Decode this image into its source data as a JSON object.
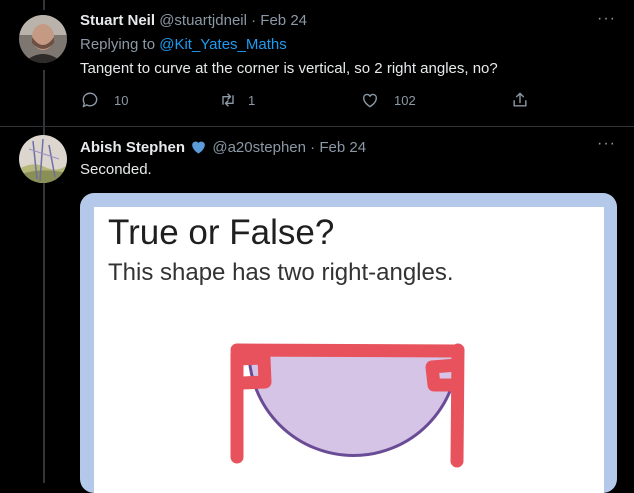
{
  "tweet1": {
    "name": "Stuart Neil",
    "handle": "@stuartjdneil",
    "date": "· Feb 24",
    "replying_prefix": "Replying to",
    "replying_to": "@Kit_Yates_Maths",
    "text": "Tangent to curve at the corner is vertical, so 2 right angles, no?",
    "replies": "10",
    "retweets": "1",
    "likes": "102"
  },
  "tweet2": {
    "name": "Abish Stephen",
    "handle": "@a20stephen",
    "date": "· Feb 24",
    "text": "Seconded.",
    "verified_color": "#5b9bd8"
  },
  "image": {
    "title": "True or False?",
    "subtitle": "This shape has two right-angles.",
    "shape_fill": "#d6c4e6",
    "shape_stroke": "#6a4c96",
    "annotation_color": "#e8525c"
  },
  "icons": {
    "more": "more-icon",
    "reply": "reply-icon",
    "retweet": "retweet-icon",
    "like": "like-icon",
    "share": "share-icon",
    "verified": "verified-badge-icon"
  }
}
